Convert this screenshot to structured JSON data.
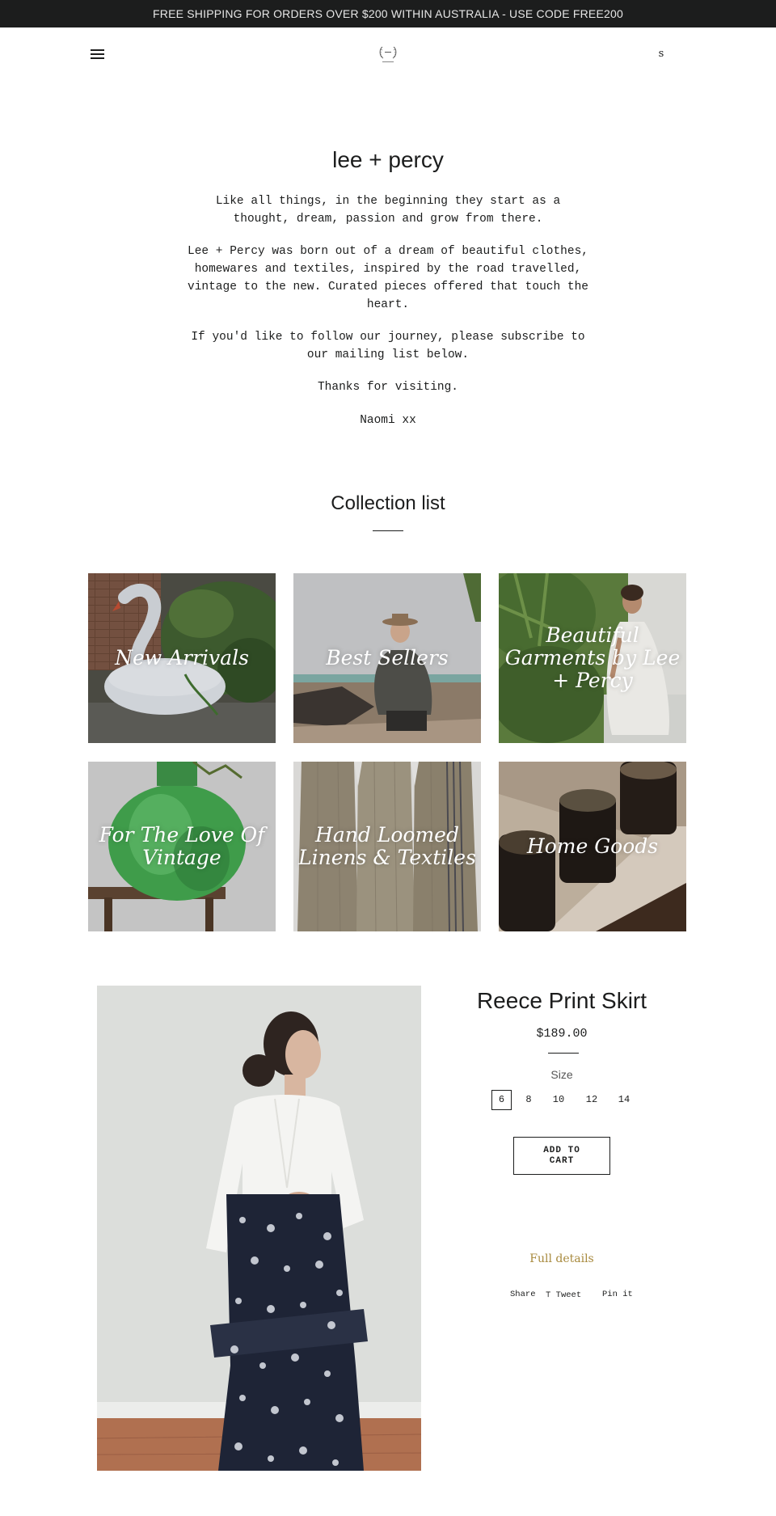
{
  "announcement": {
    "text": "FREE SHIPPING FOR ORDERS OVER $200 WITHIN AUSTRALIA - USE CODE FREE200"
  },
  "header": {
    "search_glyph": "s"
  },
  "about": {
    "title": "lee + percy",
    "paragraphs": [
      "Like all things, in the beginning they start as a thought, dream, passion and grow from there.",
      "Lee + Percy was born out of a dream of beautiful clothes, homewares and textiles, inspired by the road travelled, vintage to the new. Curated pieces offered that touch the heart.",
      "If you'd like to follow our journey, please subscribe to our mailing list below.",
      "Thanks for visiting.",
      "Naomi xx"
    ]
  },
  "collections": {
    "title": "Collection list",
    "items": [
      {
        "label": "New Arrivals"
      },
      {
        "label": "Best Sellers"
      },
      {
        "label": "Beautiful Garments by Lee + Percy"
      },
      {
        "label": "For The Love Of Vintage"
      },
      {
        "label": "Hand Loomed Linens & Textiles"
      },
      {
        "label": "Home Goods"
      }
    ]
  },
  "product": {
    "title": "Reece Print Skirt",
    "price": "$189.00",
    "size_label": "Size",
    "sizes": [
      "6",
      "8",
      "10",
      "12",
      "14"
    ],
    "selected_size": "6",
    "add_to_cart": "ADD TO CART",
    "full_details": "Full details",
    "share": {
      "share_label": "Share",
      "tweet_label": "Tweet",
      "pin_label": "Pin it"
    }
  },
  "colors": {
    "announcement_bg": "#1c1d1d",
    "text": "#1c1d1d",
    "accent_link": "#a88a3e"
  }
}
